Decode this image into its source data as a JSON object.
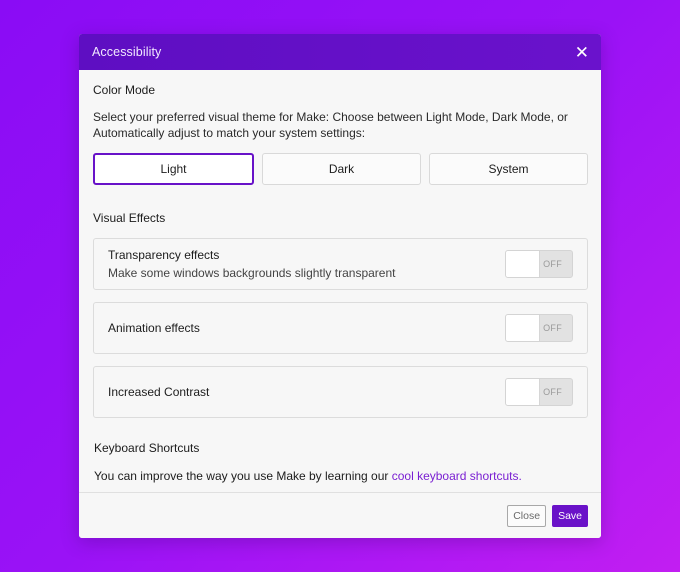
{
  "dialog": {
    "title": "Accessibility",
    "close_icon": "close-icon"
  },
  "color_mode": {
    "title": "Color Mode",
    "description": "Select your preferred visual theme for Make: Choose between Light Mode, Dark Mode, or Automatically adjust to match your system settings:",
    "options": [
      "Light",
      "Dark",
      "System"
    ],
    "selected": "Light"
  },
  "visual_effects": {
    "title": "Visual Effects",
    "items": [
      {
        "label": "Transparency effects",
        "sublabel": "Make some windows backgrounds slightly transparent",
        "state": "OFF"
      },
      {
        "label": "Animation effects",
        "state": "OFF"
      },
      {
        "label": "Increased Contrast",
        "state": "OFF"
      }
    ]
  },
  "keyboard": {
    "title": "Keyboard Shortcuts",
    "text": "You can improve the way you use Make by learning our ",
    "link": "cool keyboard shortcuts."
  },
  "footer": {
    "close_label": "Close",
    "save_label": "Save"
  },
  "colors": {
    "accent": "#6a12c8",
    "background_start": "#8a0cf5",
    "background_end": "#c21ef2"
  }
}
